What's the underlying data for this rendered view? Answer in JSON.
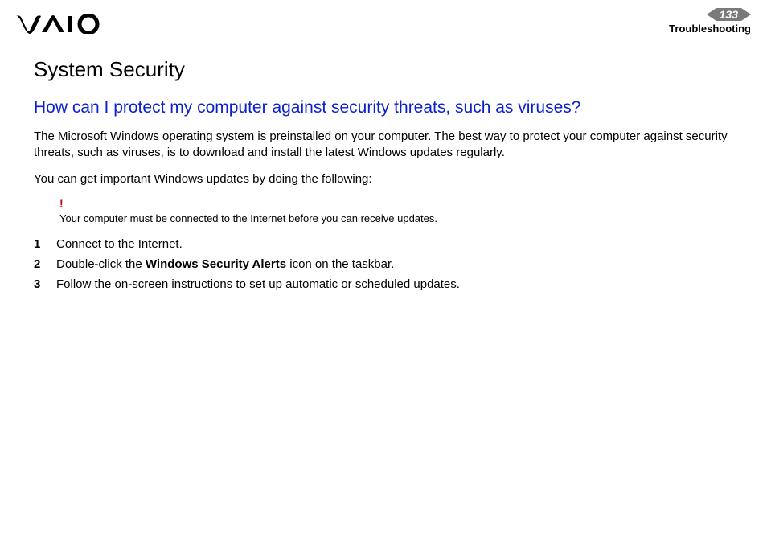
{
  "header": {
    "page_number": "133",
    "section": "Troubleshooting"
  },
  "content": {
    "title": "System Security",
    "question": "How can I protect my computer against security threats, such as viruses?",
    "para1": "The Microsoft Windows operating system is preinstalled on your computer. The best way to protect your computer against security threats, such as viruses, is to download and install the latest Windows updates regularly.",
    "para2": "You can get important Windows updates by doing the following:",
    "note_mark": "!",
    "note_text": "Your computer must be connected to the Internet before you can receive updates.",
    "steps": [
      {
        "n": "1",
        "text_before": "Connect to the Internet.",
        "bold": "",
        "text_after": ""
      },
      {
        "n": "2",
        "text_before": "Double-click the ",
        "bold": "Windows Security Alerts",
        "text_after": " icon on the taskbar."
      },
      {
        "n": "3",
        "text_before": "Follow the on-screen instructions to set up automatic or scheduled updates.",
        "bold": "",
        "text_after": ""
      }
    ]
  }
}
